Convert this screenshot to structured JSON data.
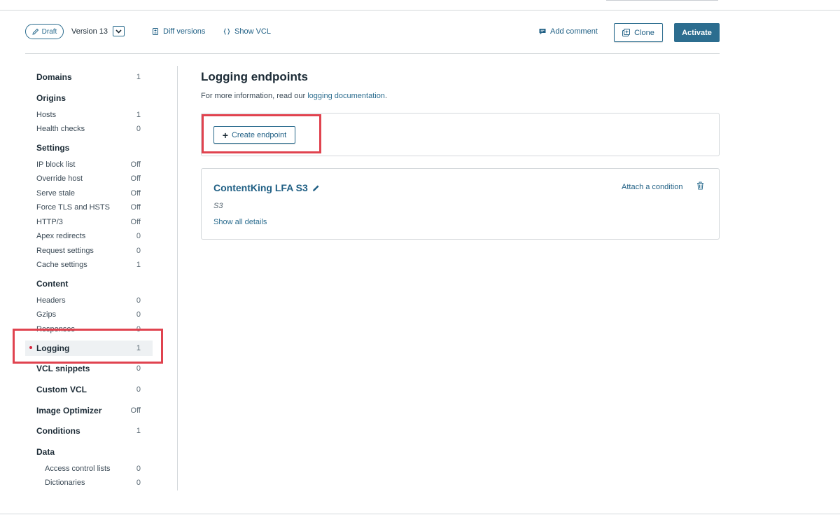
{
  "toolbar": {
    "draft_label": "Draft",
    "version_label": "Version 13",
    "diff_versions": "Diff versions",
    "show_vcl": "Show VCL",
    "add_comment": "Add comment",
    "clone": "Clone",
    "activate": "Activate"
  },
  "sidebar": {
    "items": [
      {
        "label": "Domains",
        "count": "1"
      },
      {
        "label": "Origins",
        "count": ""
      },
      {
        "label": "Hosts",
        "count": "1"
      },
      {
        "label": "Health checks",
        "count": "0"
      },
      {
        "label": "Settings",
        "count": ""
      },
      {
        "label": "IP block list",
        "count": "Off"
      },
      {
        "label": "Override host",
        "count": "Off"
      },
      {
        "label": "Serve stale",
        "count": "Off"
      },
      {
        "label": "Force TLS and HSTS",
        "count": "Off"
      },
      {
        "label": "HTTP/3",
        "count": "Off"
      },
      {
        "label": "Apex redirects",
        "count": "0"
      },
      {
        "label": "Request settings",
        "count": "0"
      },
      {
        "label": "Cache settings",
        "count": "1"
      },
      {
        "label": "Content",
        "count": ""
      },
      {
        "label": "Headers",
        "count": "0"
      },
      {
        "label": "Gzips",
        "count": "0"
      },
      {
        "label": "Responses",
        "count": "0"
      },
      {
        "label": "Logging",
        "count": "1"
      },
      {
        "label": "VCL snippets",
        "count": "0"
      },
      {
        "label": "Custom VCL",
        "count": "0"
      },
      {
        "label": "Image Optimizer",
        "count": "Off"
      },
      {
        "label": "Conditions",
        "count": "1"
      },
      {
        "label": "Data",
        "count": ""
      },
      {
        "label": "Access control lists",
        "count": "0"
      },
      {
        "label": "Dictionaries",
        "count": "0"
      }
    ]
  },
  "main": {
    "title": "Logging endpoints",
    "info_prefix": "For more information, read our ",
    "info_link": "logging documentation",
    "info_suffix": ".",
    "create_button": "Create endpoint",
    "endpoint": {
      "name": "ContentKing LFA S3",
      "type": "S3",
      "attach_condition": "Attach a condition",
      "show_details": "Show all details"
    }
  },
  "colors": {
    "accent": "#2c6d8f",
    "link": "#1f5f84",
    "highlight": "#e0434f",
    "active_dot": "#d7263d"
  }
}
